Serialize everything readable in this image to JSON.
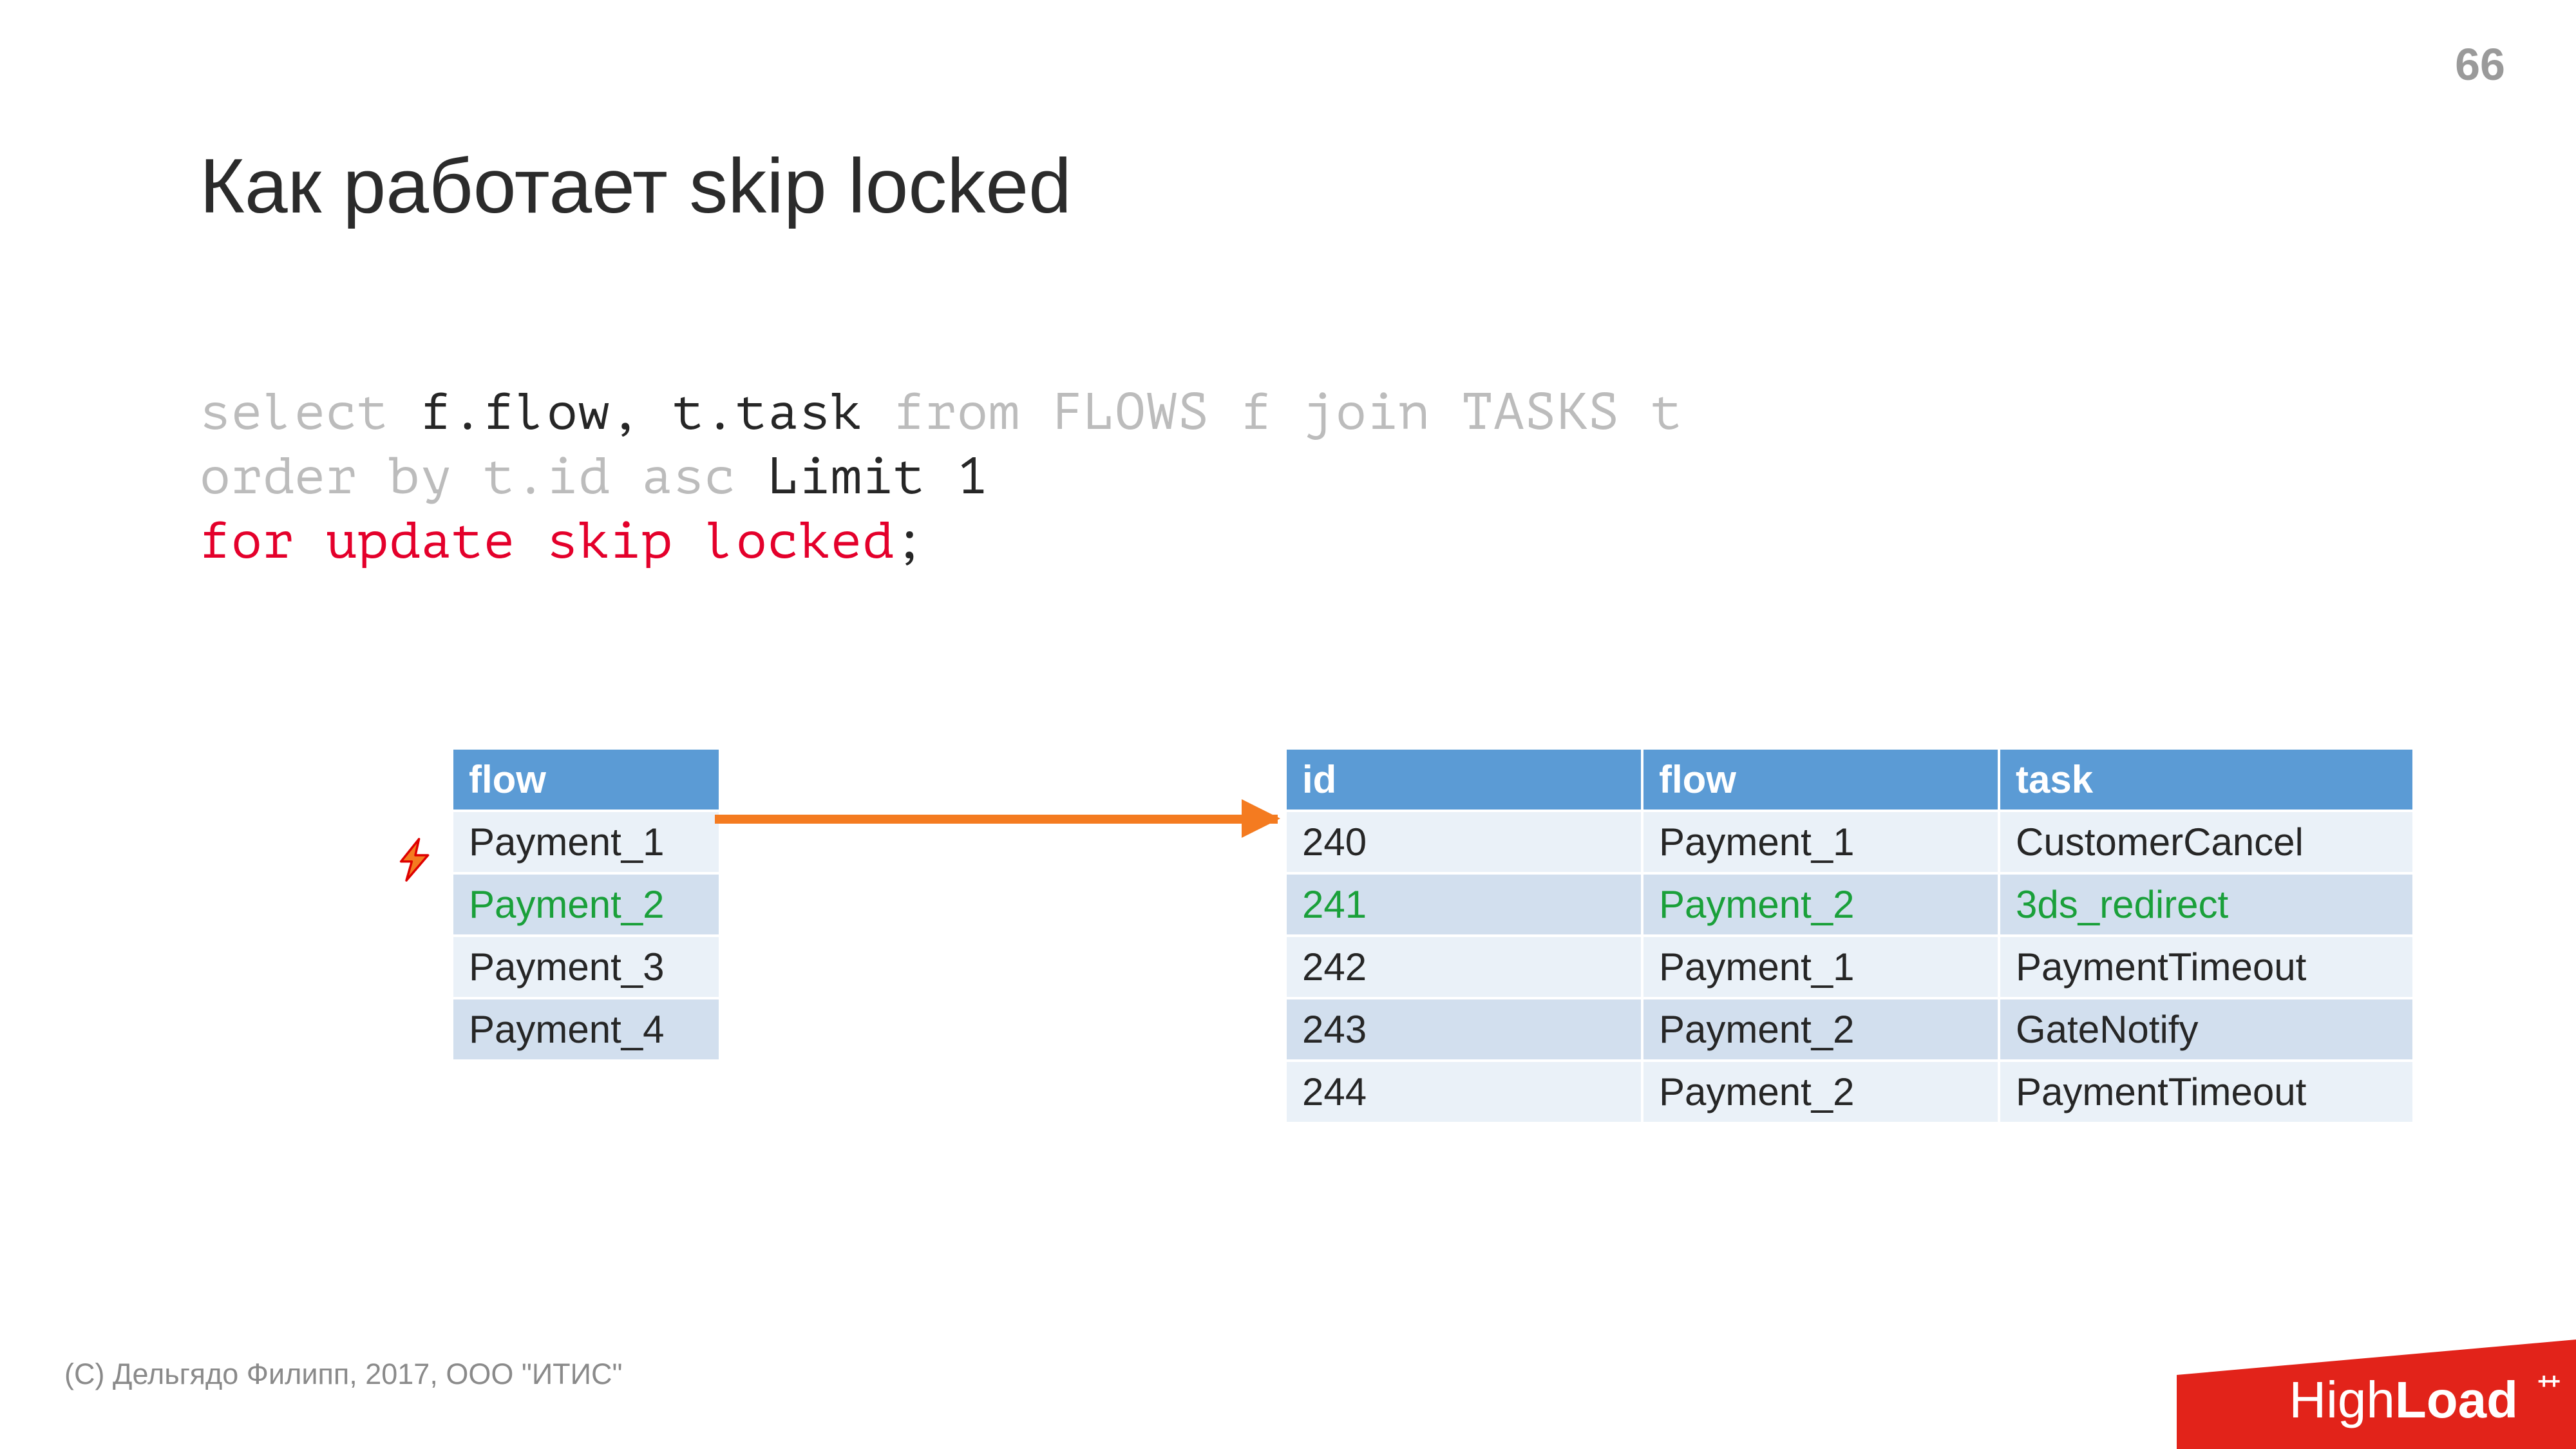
{
  "page_number": "66",
  "title": "Как работает skip locked",
  "sql": {
    "line1a": "select ",
    "line1b": "f.flow, t.task ",
    "line1c": "from FLOWS f join TASKS t",
    "line2a": "order by t.id asc ",
    "line2b": "Limit 1",
    "line3a": "for update skip locked",
    "line3b": ";"
  },
  "flows": {
    "header": "flow",
    "rows": [
      {
        "flow": "Payment_1",
        "green": false
      },
      {
        "flow": "Payment_2",
        "green": true
      },
      {
        "flow": "Payment_3",
        "green": false
      },
      {
        "flow": "Payment_4",
        "green": false
      }
    ]
  },
  "tasks": {
    "headers": {
      "id": "id",
      "flow": "flow",
      "task": "task"
    },
    "rows": [
      {
        "id": "240",
        "flow": "Payment_1",
        "task": "CustomerCancel",
        "green": false
      },
      {
        "id": "241",
        "flow": "Payment_2",
        "task": "3ds_redirect",
        "green": true
      },
      {
        "id": "242",
        "flow": "Payment_1",
        "task": "PaymentTimeout",
        "green": false
      },
      {
        "id": "243",
        "flow": "Payment_2",
        "task": "GateNotify",
        "green": false
      },
      {
        "id": "244",
        "flow": "Payment_2",
        "task": "PaymentTimeout",
        "green": false
      }
    ]
  },
  "footer": "(C) Дельгядо Филипп, 2017, ООО \"ИТИС\"",
  "logo": {
    "thin": "High",
    "bold": "Load",
    "plus": "++"
  },
  "colors": {
    "header_bg": "#5b9bd5",
    "row_light": "#eaf1f8",
    "row_dark": "#d2dfee",
    "arrow": "#f47b20",
    "logo": "#e2231a",
    "green": "#1aa03a"
  }
}
